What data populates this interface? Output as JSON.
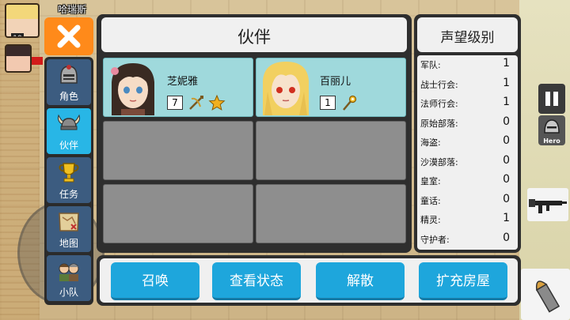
{
  "party": {
    "leader_name": "哈瑞斯",
    "leader_level": "10"
  },
  "side_menu": {
    "items": [
      {
        "label": "角色",
        "icon": "helmet-icon"
      },
      {
        "label": "伙伴",
        "icon": "viking-helmet-icon"
      },
      {
        "label": "任务",
        "icon": "trophy-icon"
      },
      {
        "label": "地图",
        "icon": "map-icon"
      },
      {
        "label": "小队",
        "icon": "squad-icon"
      }
    ],
    "active_index": 1
  },
  "companions_panel": {
    "title": "伙伴",
    "allies": [
      {
        "name": "芝妮雅",
        "level": "7",
        "weapon_icon": "crossbow-icon",
        "skill_icon": "star-icon"
      },
      {
        "name": "百丽儿",
        "level": "1",
        "weapon_icon": "staff-icon"
      }
    ],
    "empty_slots": 4
  },
  "reputation": {
    "title": "声望级别",
    "rows": [
      {
        "name": "军队:",
        "value": "1"
      },
      {
        "name": "战士行会:",
        "value": "1"
      },
      {
        "name": "法师行会:",
        "value": "1"
      },
      {
        "name": "原始部落:",
        "value": "0"
      },
      {
        "name": "海盗:",
        "value": "0"
      },
      {
        "name": "沙漠部落:",
        "value": "0"
      },
      {
        "name": "皇室:",
        "value": "0"
      },
      {
        "name": "童话:",
        "value": "0"
      },
      {
        "name": "精灵:",
        "value": "1"
      },
      {
        "name": "守护者:",
        "value": "0"
      }
    ]
  },
  "actions": {
    "summon": "召唤",
    "view_status": "查看状态",
    "dismiss": "解散",
    "expand_house": "扩充房屋"
  },
  "hud": {
    "hero_label": "Hero"
  },
  "colors": {
    "accent": "#1ea6dc",
    "close": "#ff8a1a",
    "slot_filled": "#9fd9dc"
  }
}
